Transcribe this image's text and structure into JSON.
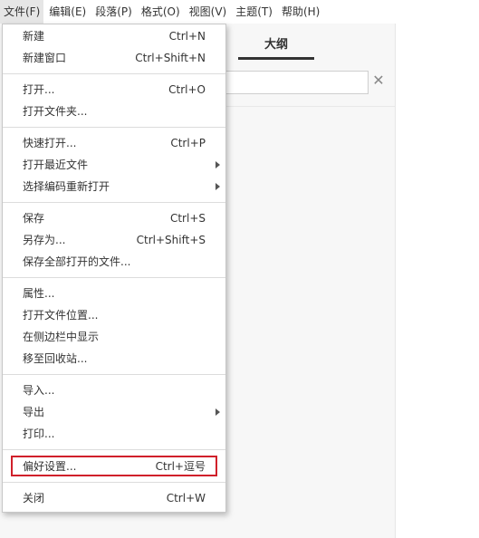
{
  "menubar": {
    "items": [
      {
        "label": "文件(F)",
        "active": true
      },
      {
        "label": "编辑(E)"
      },
      {
        "label": "段落(P)"
      },
      {
        "label": "格式(O)"
      },
      {
        "label": "视图(V)"
      },
      {
        "label": "主题(T)"
      },
      {
        "label": "帮助(H)"
      }
    ]
  },
  "sidebar": {
    "outline_tab": "大纲",
    "search_placeholder": "",
    "close_glyph": "✕"
  },
  "file_menu": {
    "items": [
      {
        "label": "新建",
        "shortcut": "Ctrl+N"
      },
      {
        "label": "新建窗口",
        "shortcut": "Ctrl+Shift+N"
      },
      {
        "label": "打开...",
        "shortcut": "Ctrl+O"
      },
      {
        "label": "打开文件夹...",
        "shortcut": ""
      },
      {
        "label": "快速打开...",
        "shortcut": "Ctrl+P"
      },
      {
        "label": "打开最近文件",
        "shortcut": "",
        "submenu": true
      },
      {
        "label": "选择编码重新打开",
        "shortcut": "",
        "submenu": true
      },
      {
        "label": "保存",
        "shortcut": "Ctrl+S"
      },
      {
        "label": "另存为...",
        "shortcut": "Ctrl+Shift+S"
      },
      {
        "label": "保存全部打开的文件...",
        "shortcut": ""
      },
      {
        "label": "属性...",
        "shortcut": ""
      },
      {
        "label": "打开文件位置...",
        "shortcut": ""
      },
      {
        "label": "在侧边栏中显示",
        "shortcut": ""
      },
      {
        "label": "移至回收站...",
        "shortcut": ""
      },
      {
        "label": "导入...",
        "shortcut": ""
      },
      {
        "label": "导出",
        "shortcut": "",
        "submenu": true
      },
      {
        "label": "打印...",
        "shortcut": ""
      },
      {
        "label": "偏好设置...",
        "shortcut": "Ctrl+逗号",
        "highlighted": true
      },
      {
        "label": "关闭",
        "shortcut": "Ctrl+W"
      }
    ]
  },
  "colors": {
    "highlight_border": "#d0202a",
    "active_menubar_bg": "#e6e6e6"
  }
}
